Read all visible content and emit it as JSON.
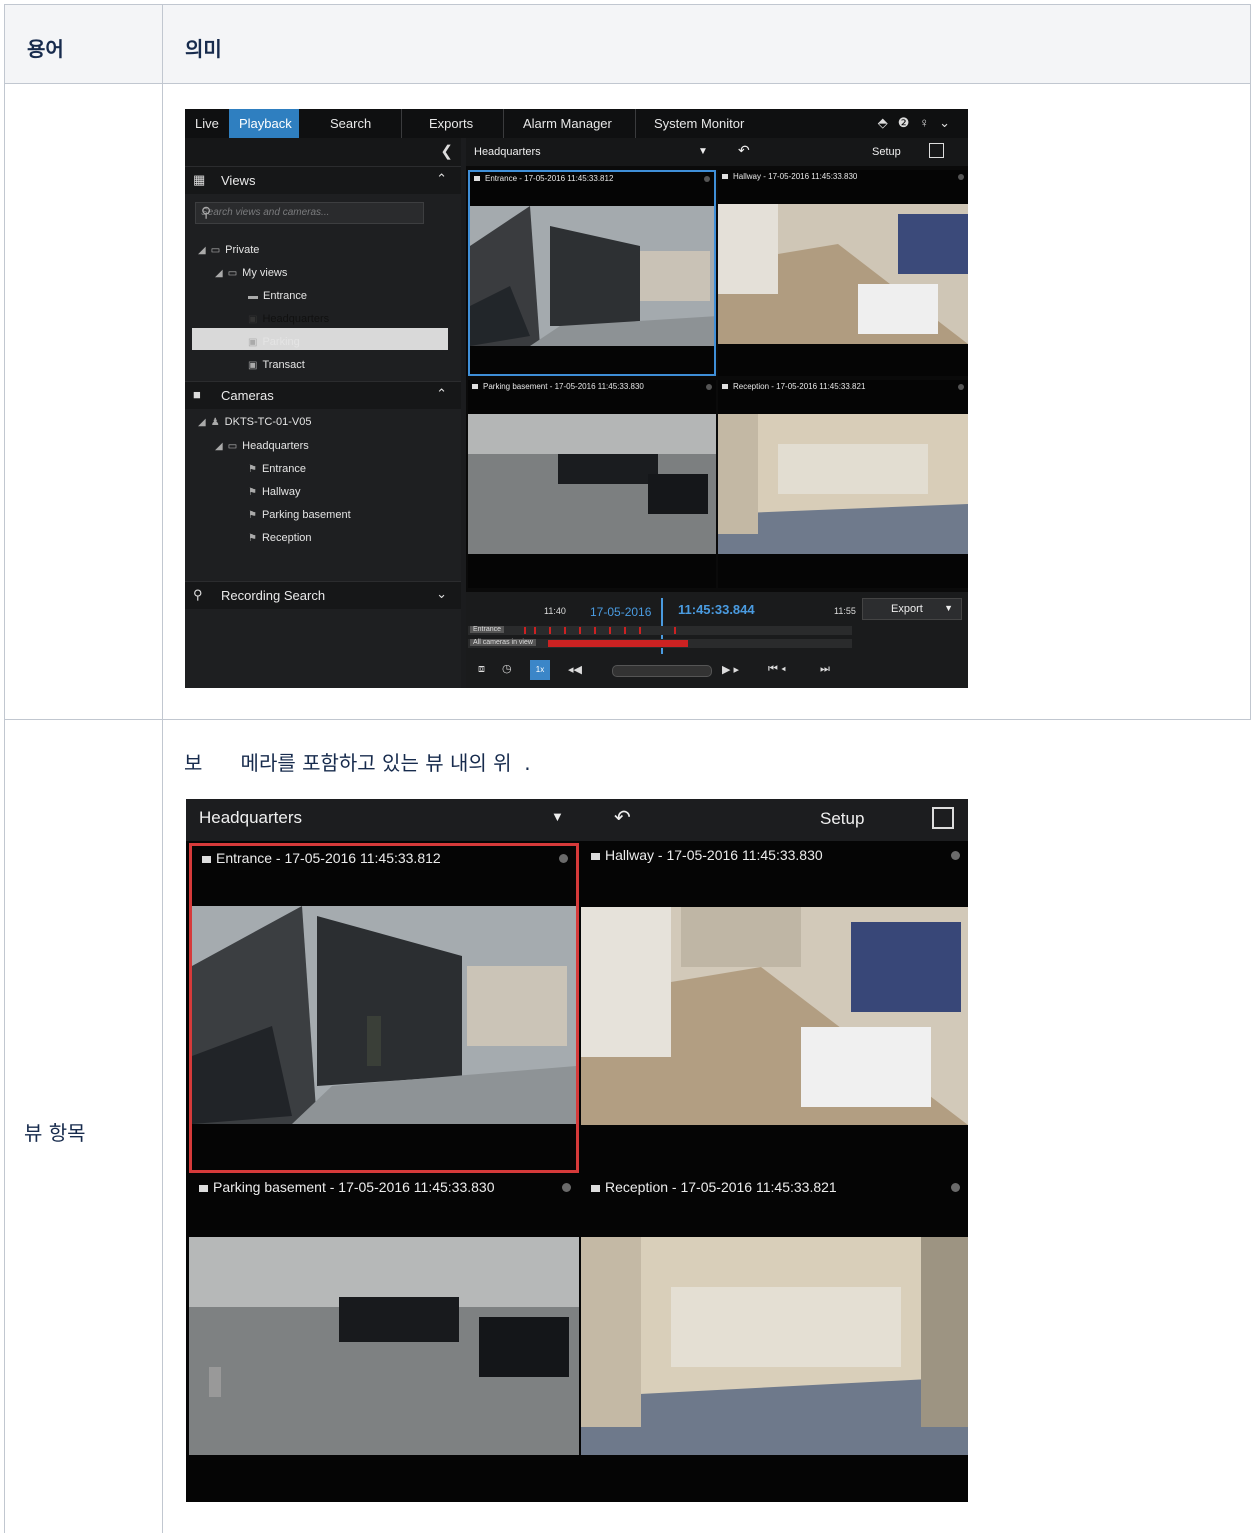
{
  "table": {
    "col_term": "용어",
    "col_meaning": "의미",
    "row2_term": "뷰 항목",
    "row2_desc": "보      메라를 포함하고 있는 뷰 내의 위  ."
  },
  "app": {
    "tabs": [
      "Live",
      "Playback",
      "Search",
      "Exports",
      "Alarm Manager",
      "System Monitor"
    ],
    "active_tab": "Playback",
    "view_name": "Headquarters",
    "setup_label": "Setup",
    "views_label": "Views",
    "search_placeholder": "Search views and cameras...",
    "views_tree": {
      "private": "Private",
      "my_views": "My views",
      "items": [
        "Entrance",
        "Headquarters",
        "Parking",
        "Transact"
      ]
    },
    "cameras_label": "Cameras",
    "cameras_tree": {
      "server": "DKTS-TC-01-V05",
      "folder": "Headquarters",
      "items": [
        "Entrance",
        "Hallway",
        "Parking basement",
        "Reception"
      ]
    },
    "recording_search_label": "Recording Search",
    "tiles": [
      "Entrance - 17-05-2016 11:45:33.812",
      "Hallway - 17-05-2016 11:45:33.830",
      "Parking basement - 17-05-2016 11:45:33.830",
      "Reception - 17-05-2016 11:45:33.821"
    ],
    "timeline": {
      "time_left": "11:40",
      "date": "17-05-2016",
      "current_time": "11:45:33.844",
      "time_right": "11:55",
      "track1": "Entrance",
      "track2": "All cameras in view",
      "speed": "1x",
      "export_label": "Export"
    }
  },
  "colors": {
    "accent_blue": "#2f7fc0",
    "selection_red": "#d63a3a",
    "timeline_red": "#cc2222"
  }
}
